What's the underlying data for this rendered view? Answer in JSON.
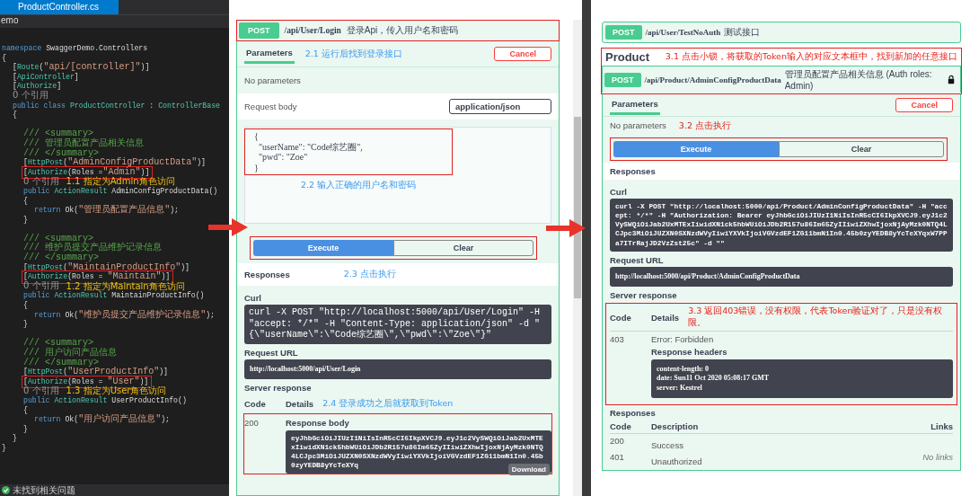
{
  "editor": {
    "tab": "ProductController.cs",
    "project": "emo",
    "lines": [
      {
        "tokens": [
          {
            "kind": "keyword",
            "text": "namespace"
          },
          {
            "kind": "plain",
            "text": " SwaggerDemo.Controllers"
          }
        ]
      },
      {
        "tokens": [
          {
            "kind": "plain",
            "text": "{"
          }
        ]
      },
      {
        "tokens": [
          {
            "kind": "plain",
            "text": "    ["
          },
          {
            "kind": "type",
            "text": "Route"
          },
          {
            "kind": "plain",
            "text": "("
          },
          {
            "kind": "string",
            "text": "\"api/[controller]\""
          },
          {
            "kind": "plain",
            "text": ")]"
          }
        ]
      },
      {
        "tokens": [
          {
            "kind": "plain",
            "text": "    ["
          },
          {
            "kind": "type",
            "text": "ApiController"
          },
          {
            "kind": "plain",
            "text": "]"
          }
        ]
      },
      {
        "tokens": [
          {
            "kind": "plain",
            "text": "    ["
          },
          {
            "kind": "type",
            "text": "Authorize"
          },
          {
            "kind": "plain",
            "text": "]"
          }
        ]
      },
      {
        "tokens": [
          {
            "kind": "ref",
            "text": "    0 个引用"
          }
        ]
      },
      {
        "tokens": [
          {
            "kind": "keyword",
            "text": "    public class"
          },
          {
            "kind": "type",
            "text": " ProductController"
          },
          {
            "kind": "plain",
            "text": " : "
          },
          {
            "kind": "type",
            "text": "ControllerBase"
          }
        ]
      },
      {
        "tokens": [
          {
            "kind": "plain",
            "text": "    {"
          }
        ]
      },
      {
        "kind": "blank"
      },
      {
        "tokens": [
          {
            "kind": "comment",
            "text": "        /// <summary>"
          }
        ]
      },
      {
        "tokens": [
          {
            "kind": "comment",
            "text": "        /// 管理员配置产品相关信息"
          }
        ]
      },
      {
        "tokens": [
          {
            "kind": "comment",
            "text": "        /// </summary>"
          }
        ]
      },
      {
        "tokens": [
          {
            "kind": "plain",
            "text": "        ["
          },
          {
            "kind": "type",
            "text": "HttpPost"
          },
          {
            "kind": "plain",
            "text": "("
          },
          {
            "kind": "string",
            "text": "\"AdminConfigProductData\""
          },
          {
            "kind": "plain",
            "text": ")]"
          }
        ]
      },
      {
        "tokens": [
          {
            "kind": "plain",
            "text": "        ["
          },
          {
            "kind": "type",
            "text": "Authorize"
          },
          {
            "kind": "plain",
            "text": "(Roles ="
          },
          {
            "kind": "string",
            "text": "\"Admin\""
          },
          {
            "kind": "plain",
            "text": ")]"
          }
        ],
        "boxed": true
      },
      {
        "tokens": [
          {
            "kind": "ref",
            "text": "        0 个引用"
          }
        ],
        "note": "1.1 指定为Admin角色访问"
      },
      {
        "tokens": [
          {
            "kind": "keyword",
            "text": "        public"
          },
          {
            "kind": "type",
            "text": " ActionResult"
          },
          {
            "kind": "plain",
            "text": " AdminConfigProductData()"
          }
        ]
      },
      {
        "tokens": [
          {
            "kind": "plain",
            "text": "        {"
          }
        ]
      },
      {
        "tokens": [
          {
            "kind": "keyword",
            "text": "            return"
          },
          {
            "kind": "plain",
            "text": " Ok("
          },
          {
            "kind": "string",
            "text": "\"管理员配置产品信息\""
          },
          {
            "kind": "plain",
            "text": ");"
          }
        ]
      },
      {
        "tokens": [
          {
            "kind": "plain",
            "text": "        }"
          }
        ]
      },
      {
        "kind": "blank"
      },
      {
        "tokens": [
          {
            "kind": "comment",
            "text": "        /// <summary>"
          }
        ]
      },
      {
        "tokens": [
          {
            "kind": "comment",
            "text": "        /// 维护员提交产品维护记录信息"
          }
        ]
      },
      {
        "tokens": [
          {
            "kind": "comment",
            "text": "        /// </summary>"
          }
        ]
      },
      {
        "tokens": [
          {
            "kind": "plain",
            "text": "        ["
          },
          {
            "kind": "type",
            "text": "HttpPost"
          },
          {
            "kind": "plain",
            "text": "("
          },
          {
            "kind": "string",
            "text": "\"MaintainProductInfo\""
          },
          {
            "kind": "plain",
            "text": ")]"
          }
        ]
      },
      {
        "tokens": [
          {
            "kind": "plain",
            "text": "        ["
          },
          {
            "kind": "type",
            "text": "Authorize"
          },
          {
            "kind": "plain",
            "text": "(Roles = "
          },
          {
            "kind": "string",
            "text": "\"Maintain\""
          },
          {
            "kind": "plain",
            "text": ")]"
          }
        ],
        "boxed": true
      },
      {
        "tokens": [
          {
            "kind": "ref",
            "text": "        0 个引用"
          }
        ],
        "note": "1.2 指定为Maintain角色访问"
      },
      {
        "tokens": [
          {
            "kind": "keyword",
            "text": "        public"
          },
          {
            "kind": "type",
            "text": " ActionResult"
          },
          {
            "kind": "plain",
            "text": " MaintainProductInfo()"
          }
        ]
      },
      {
        "tokens": [
          {
            "kind": "plain",
            "text": "        {"
          }
        ]
      },
      {
        "tokens": [
          {
            "kind": "keyword",
            "text": "            return"
          },
          {
            "kind": "plain",
            "text": " Ok("
          },
          {
            "kind": "string",
            "text": "\"维护员提交产品维护记录信息\""
          },
          {
            "kind": "plain",
            "text": ");"
          }
        ]
      },
      {
        "tokens": [
          {
            "kind": "plain",
            "text": "        }"
          }
        ]
      },
      {
        "kind": "blank"
      },
      {
        "tokens": [
          {
            "kind": "comment",
            "text": "        /// <summary>"
          }
        ]
      },
      {
        "tokens": [
          {
            "kind": "comment",
            "text": "        /// 用户访问产品信息"
          }
        ]
      },
      {
        "tokens": [
          {
            "kind": "comment",
            "text": "        /// </summary>"
          }
        ]
      },
      {
        "tokens": [
          {
            "kind": "plain",
            "text": "        ["
          },
          {
            "kind": "type",
            "text": "HttpPost"
          },
          {
            "kind": "plain",
            "text": "("
          },
          {
            "kind": "string",
            "text": "\"UserProductInfo\""
          },
          {
            "kind": "plain",
            "text": ")]"
          }
        ]
      },
      {
        "tokens": [
          {
            "kind": "plain",
            "text": "        ["
          },
          {
            "kind": "type",
            "text": "Authorize"
          },
          {
            "kind": "plain",
            "text": "(Roles = "
          },
          {
            "kind": "string",
            "text": "\"User\""
          },
          {
            "kind": "plain",
            "text": ")]"
          }
        ],
        "boxed": true
      },
      {
        "tokens": [
          {
            "kind": "ref",
            "text": "        0 个引用"
          }
        ],
        "note": "1.3 指定为User角色访问"
      },
      {
        "tokens": [
          {
            "kind": "keyword",
            "text": "        public"
          },
          {
            "kind": "type",
            "text": " ActionResult"
          },
          {
            "kind": "plain",
            "text": " UserProductInfo()"
          }
        ]
      },
      {
        "tokens": [
          {
            "kind": "plain",
            "text": "        {"
          }
        ]
      },
      {
        "tokens": [
          {
            "kind": "keyword",
            "text": "            return"
          },
          {
            "kind": "plain",
            "text": " Ok("
          },
          {
            "kind": "string",
            "text": "\"用户访问产品信息\""
          },
          {
            "kind": "plain",
            "text": ");"
          }
        ]
      },
      {
        "tokens": [
          {
            "kind": "plain",
            "text": "        }"
          }
        ]
      },
      {
        "tokens": [
          {
            "kind": "plain",
            "text": "    }"
          }
        ]
      },
      {
        "tokens": [
          {
            "kind": "plain",
            "text": "}"
          }
        ]
      }
    ],
    "status": "未找到相关问题"
  },
  "login_page": {
    "operation": {
      "method": "POST",
      "path": "/api/User/Login",
      "summary": "登录Api，传入用户名和密码",
      "boxed": true
    },
    "tabs": [
      {
        "label": "Parameters",
        "selected": true
      }
    ],
    "tabs_note": "2.1 运行后找到登录接口",
    "cancel": "Cancel",
    "no_params": "No parameters",
    "request_body_label": "Request body",
    "content_type": "application/json",
    "body": {
      "value": "{\n  \"userName\": \"Code综艺圈\",\n  \"pwd\": \"Zoe\"\n}",
      "boxed": true,
      "note": "2.2 输入正确的用户名和密码"
    },
    "execute": "Execute",
    "clear": "Clear",
    "buttons_boxed": true,
    "responses_label": "Responses",
    "responses_note": "2.3 点击执行",
    "curl_label": "Curl",
    "curl": "curl -X POST \"http://localhost:5000/api/User/Login\" -H  \"accept: */*\" -H \"Content-Type: application/json\" -d \"{\\\"userName\\\":\\\"Code综艺圈\\\",\\\"pwd\\\":\\\"Zoe\\\"}\"",
    "request_url_label": "Request URL",
    "request_url": "http://localhost:5000/api/User/Login",
    "server_response_label": "Server response",
    "columns": [
      "Code",
      "Details"
    ],
    "columns_note": "2.4 登录成功之后就获取到Token",
    "result": {
      "code": "200",
      "body_label": "Response body",
      "body": "eyJhbGciOiJIUzI1NiIsInR5cCI6IkpXVCJ9.eyJ1c2VySWQiOiJab2UxMTExIiwidXN1ck5hbWUiOiJDb2R157u86Im65ZyIIiwiZXhwIjoxNjAyMzk0NTQ4LCJpc3MiOiJUZXN0SXNzdWVyIiwiYXVkIjoiVGVzdEF1ZG11bmN1In0.45b0zyYEDB8yYcTeXYq",
      "download": "Download",
      "boxed": true
    }
  },
  "product_page": {
    "other_operations": [
      {
        "method": "POST",
        "path": "/api/User/TestNoAuth",
        "summary": "测试接口"
      }
    ],
    "section": "Product",
    "section_note": "3.1 点击小锁，将获取的Token输入的对应文本框中，找到新加的任意接口",
    "operation": {
      "method": "POST",
      "path": "/api/Product/AdminConfigProductData",
      "summary": "管理员配置产品相关信息 (Auth roles: Admin)",
      "locked": true,
      "boxed": true
    },
    "tabs": [
      {
        "label": "Parameters",
        "selected": true
      }
    ],
    "cancel": "Cancel",
    "no_params": "No parameters",
    "params_note": "3.2 点击执行",
    "execute": "Execute",
    "clear": "Clear",
    "buttons_boxed": true,
    "responses_label": "Responses",
    "curl_label": "Curl",
    "curl": "curl -X POST \"http://localhost:5000/api/Product/AdminConfigProductData\" -H  \"accept: */*\" -H  \"Authorization: Bearer eyJhbGciOiJIUzI1NiIsInR5cCI6IkpXVCJ9.eyJ1c2VySWQiOiJab2UxMTExIiwidXN1ck5hbWUiOiJDb2R157u86Im65ZyIIiwiZXhwIjoxNjAyMzk0NTQ4LCJpc3MiOiJUZXN0SXNzdWVyIiwiYXVkIjoiVGVzdEF1ZG11bmN1In0.45b0zyYEDB8yYcTeXYqxW7PPa7ITrRajJD2VzZst25c\" -d \"\"",
    "request_url_label": "Request URL",
    "request_url": "http://localhost:5000/api/Product/AdminConfigProductData",
    "server_response_label": "Server response",
    "columns": [
      "Code",
      "Details"
    ],
    "columns_note": "3.3 返回403错误，没有权限，代表Token验证对了，只是没有权限。",
    "result": {
      "code": "403",
      "details": "Error: Forbidden",
      "headers_label": "Response headers",
      "headers": "content-length: 0\ndate: Sun11 Oct 2020 05:08:17 GMT\nserver: Kestrel",
      "boxed": true
    },
    "responses_title": "Responses",
    "response_columns": [
      "Code",
      "Description",
      "Links"
    ],
    "responses": [
      {
        "code": "200",
        "description": "Success"
      },
      {
        "code": "401",
        "description": "Unauthorized",
        "links": "No links"
      }
    ]
  }
}
